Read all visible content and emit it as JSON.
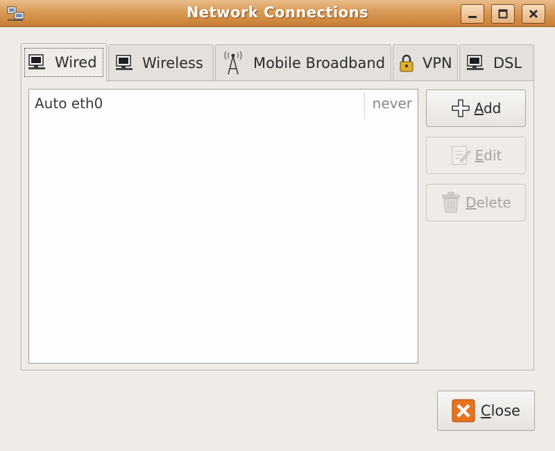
{
  "window": {
    "title": "Network Connections"
  },
  "tabs": [
    {
      "label": "Wired",
      "icon": "wired-network-icon",
      "active": true
    },
    {
      "label": "Wireless",
      "icon": "wireless-network-icon"
    },
    {
      "label": "Mobile Broadband",
      "icon": "antenna-icon"
    },
    {
      "label": "VPN",
      "icon": "lock-icon"
    },
    {
      "label": "DSL",
      "icon": "dsl-network-icon"
    }
  ],
  "connections": [
    {
      "name": "Auto eth0",
      "last_used": "never"
    }
  ],
  "buttons": {
    "add": {
      "mnemonic": "A",
      "rest": "dd"
    },
    "edit": {
      "mnemonic": "E",
      "rest": "dit"
    },
    "delete": {
      "mnemonic": "D",
      "rest": "elete"
    },
    "close": {
      "mnemonic": "C",
      "rest": "lose"
    }
  },
  "colors": {
    "titlebar": "#d99a55",
    "close_icon": "#e8731e"
  }
}
